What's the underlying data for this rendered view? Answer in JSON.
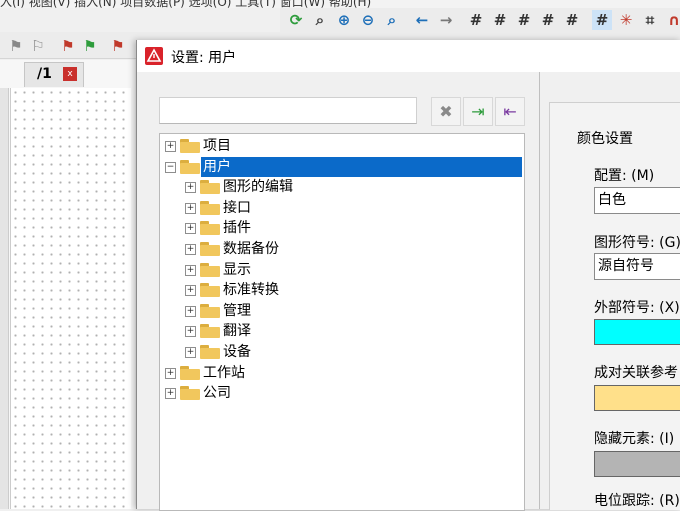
{
  "menubar": {
    "text": "入(I)  视图(V)  插入(N)  项目数据(P)  选项(O)  工具(T)  窗口(W)  帮助(H)"
  },
  "document_tab": {
    "label": "/1",
    "close": "x"
  },
  "dialog": {
    "title": "设置: 用户",
    "search": {
      "value": "",
      "placeholder": ""
    },
    "buttons": {
      "clear": "✖",
      "expand": "⇥",
      "collapse": "⇤"
    },
    "tree": [
      {
        "label": "项目",
        "expander": "+",
        "level": 0
      },
      {
        "label": "用户",
        "expander": "−",
        "level": 0,
        "selected": true
      },
      {
        "label": "图形的编辑",
        "expander": "+",
        "level": 1
      },
      {
        "label": "接口",
        "expander": "+",
        "level": 1
      },
      {
        "label": "插件",
        "expander": "+",
        "level": 1
      },
      {
        "label": "数据备份",
        "expander": "+",
        "level": 1
      },
      {
        "label": "显示",
        "expander": "+",
        "level": 1
      },
      {
        "label": "标准转换",
        "expander": "+",
        "level": 1
      },
      {
        "label": "管理",
        "expander": "+",
        "level": 1
      },
      {
        "label": "翻译",
        "expander": "+",
        "level": 1
      },
      {
        "label": "设备",
        "expander": "+",
        "level": 1
      },
      {
        "label": "工作站",
        "expander": "+",
        "level": 0
      },
      {
        "label": "公司",
        "expander": "+",
        "level": 0
      }
    ],
    "color_settings": {
      "group_title": "颜色设置",
      "config_label": "配置: (M)",
      "config_value": "白色",
      "graphic_symbol_label": "图形符号: (G)",
      "graphic_symbol_value": "源自符号",
      "external_symbol_label": "外部符号: (X)",
      "external_symbol_color": "#00ffff",
      "paired_ref_label": "成对关联参考",
      "paired_ref_color": "#ffe08a",
      "hidden_elements_label": "隐藏元素: (I)",
      "hidden_elements_color": "#b4b4b4",
      "potential_trace_label": "电位跟踪: (R)"
    }
  }
}
